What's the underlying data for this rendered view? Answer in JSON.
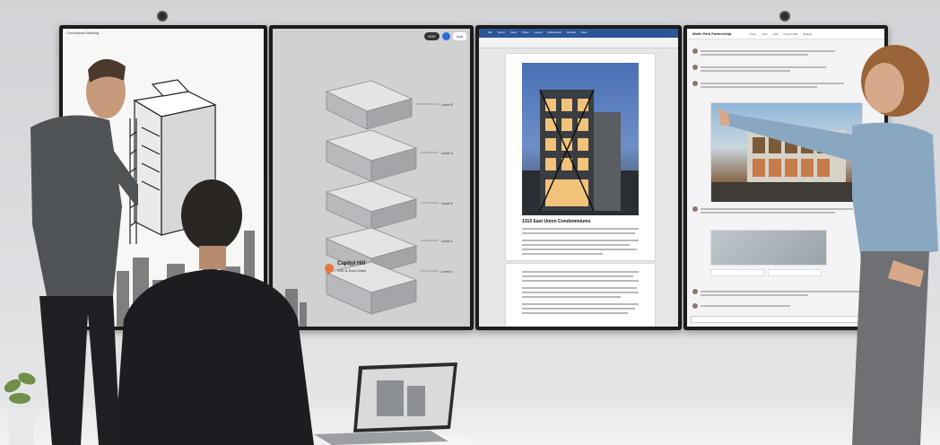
{
  "screen1": {
    "header": "Conceptual Massing"
  },
  "screen2": {
    "toolbar": {
      "user_pill": "NOE",
      "button_label": "Add"
    },
    "levels": [
      "Level 5",
      "Level 4",
      "Level 3",
      "Level 2",
      "Level 1"
    ],
    "callout_title": "Capitol Hill",
    "callout_subtitle": "13th & East Union"
  },
  "screen3": {
    "ribbon_tabs": [
      "File",
      "Home",
      "Insert",
      "Draw",
      "Layout",
      "References",
      "Review",
      "View"
    ],
    "doc_title": "1310 East Union Condominiums"
  },
  "screen4": {
    "title": "Wells Park Partnership",
    "tabs": [
      "Posts",
      "Files",
      "Wiki",
      "Project Plan",
      "Budget"
    ]
  },
  "colors": {
    "word_blue": "#2b579a",
    "pin_orange": "#e6763c",
    "wall": "#d6d7d9"
  }
}
